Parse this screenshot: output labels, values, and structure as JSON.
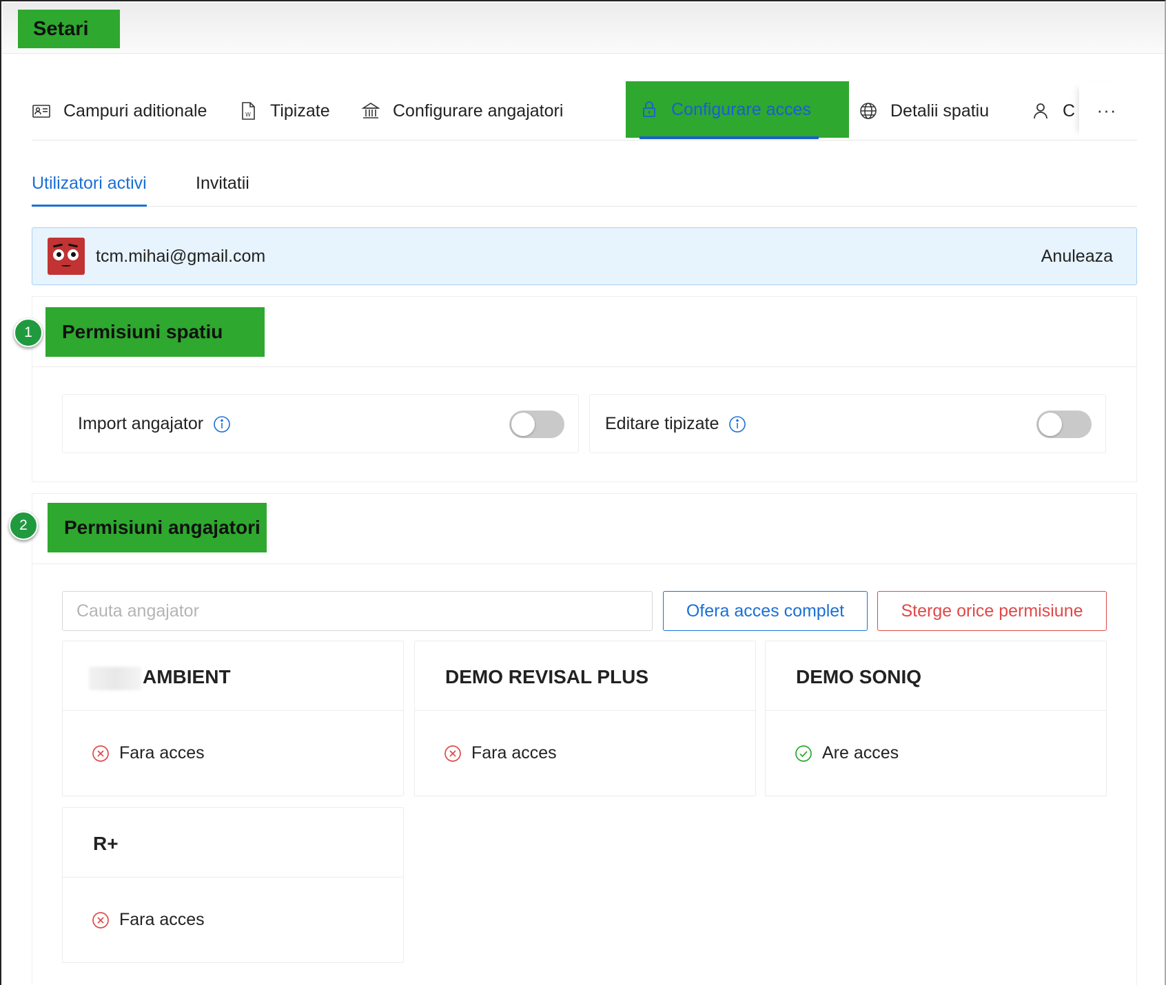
{
  "header": {
    "title": "Setari"
  },
  "tabs": [
    {
      "label": "Campuri aditionale",
      "icon": "id-card-icon"
    },
    {
      "label": "Tipizate",
      "icon": "word-document-icon"
    },
    {
      "label": "Configurare angajatori",
      "icon": "bank-icon"
    },
    {
      "label": "Configurare acces",
      "icon": "lock-icon",
      "active": true
    },
    {
      "label": "Detalii spatiu",
      "icon": "globe-icon"
    },
    {
      "label": "C",
      "icon": "user-icon"
    }
  ],
  "tabs_more_label": "···",
  "subtabs": [
    {
      "label": "Utilizatori activi",
      "active": true
    },
    {
      "label": "Invitatii"
    }
  ],
  "selected_user": {
    "email": "tcm.mihai@gmail.com",
    "cancel_label": "Anuleaza"
  },
  "space_permissions": {
    "step": "1",
    "title": "Permisiuni spatiu",
    "items": [
      {
        "label": "Import angajator",
        "enabled": false
      },
      {
        "label": "Editare tipizate",
        "enabled": false
      }
    ]
  },
  "employer_permissions": {
    "step": "2",
    "title": "Permisiuni angajatori",
    "search_placeholder": "Cauta angajator",
    "grant_all_label": "Ofera acces complet",
    "remove_all_label": "Sterge orice permisiune",
    "employers": [
      {
        "name": "AMBIENT",
        "status": "Fara acces",
        "has_access": false,
        "name_partially_redacted": true
      },
      {
        "name": "DEMO REVISAL PLUS",
        "status": "Fara acces",
        "has_access": false
      },
      {
        "name": "DEMO SONIQ",
        "status": "Are acces",
        "has_access": true
      },
      {
        "name": "R+",
        "status": "Fara acces",
        "has_access": false
      }
    ]
  },
  "colors": {
    "highlight": "#2ea82e",
    "accent_blue": "#1a6fd6",
    "danger_red": "#e04848",
    "success_green": "#2aa82a",
    "selected_user_bg": "#e7f3fd"
  }
}
